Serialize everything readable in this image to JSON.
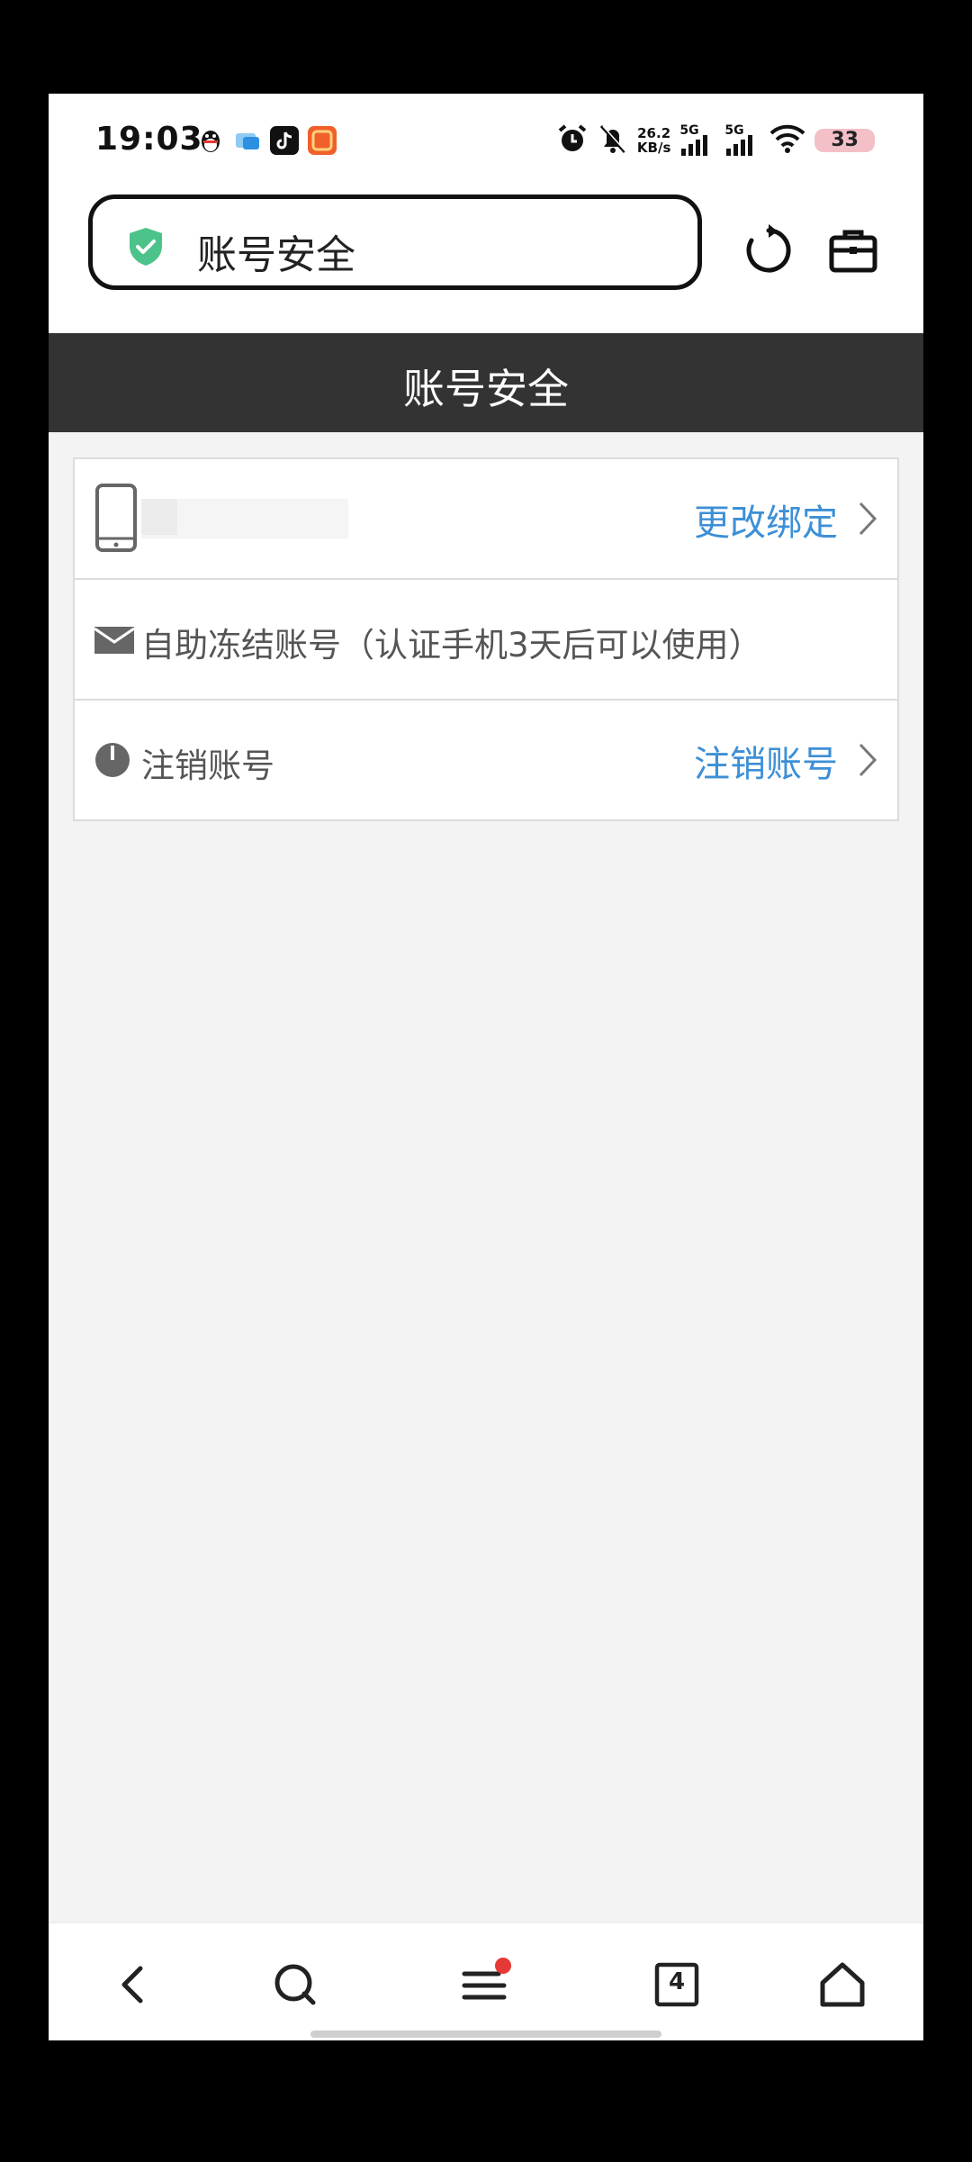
{
  "status_bar": {
    "time": "19:03",
    "network_speed_value": "26.2",
    "network_speed_unit": "KB/s",
    "signal1_label": "5G",
    "signal2_label": "5G",
    "battery": "33",
    "icons": [
      "qq-icon",
      "app-icon",
      "tiktok-icon",
      "taobao-icon",
      "alarm-icon",
      "mute-bell-icon",
      "wifi-icon"
    ]
  },
  "browser": {
    "url_text": "账号安全",
    "tab_count": "4"
  },
  "page": {
    "title": "账号安全"
  },
  "rows": {
    "phone": {
      "action": "更改绑定"
    },
    "freeze": {
      "label": "自助冻结账号（认证手机3天后可以使用）"
    },
    "cancel": {
      "label": "注销账号",
      "action": "注销账号"
    }
  },
  "colors": {
    "title_bar_bg": "#333333",
    "link_blue": "#3d8fd6",
    "content_bg": "#f3f3f3",
    "shield_green": "#4cc38a",
    "badge_red": "#e53935"
  }
}
